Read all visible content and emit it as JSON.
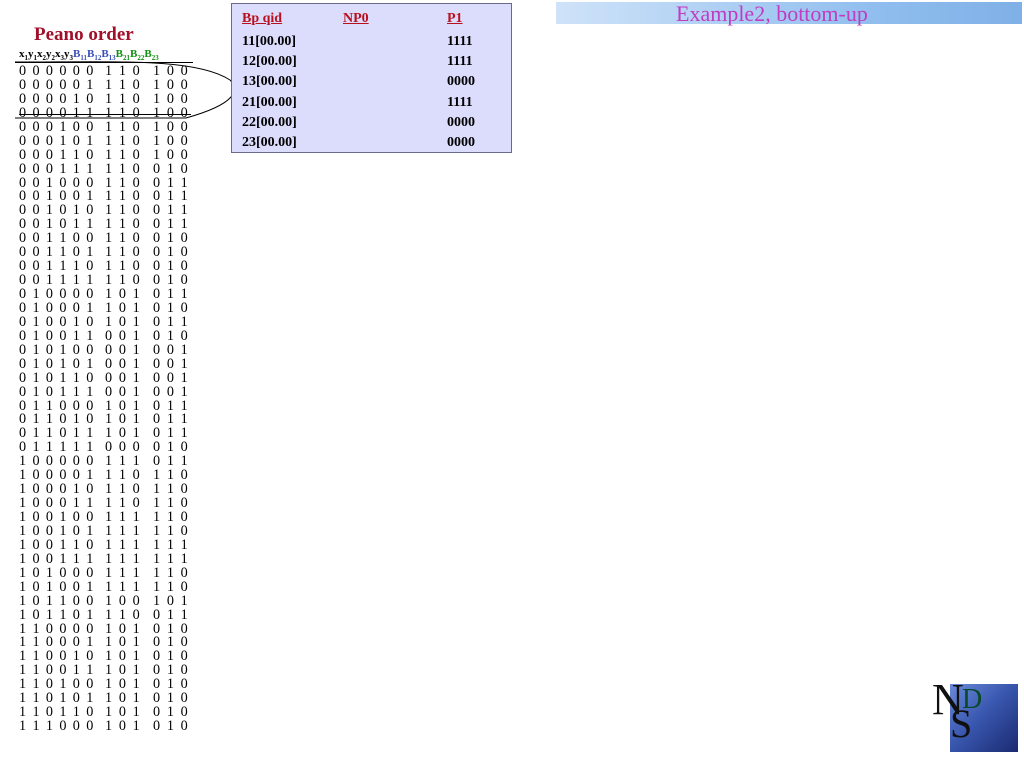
{
  "slide_title": "Example2, bottom-up",
  "peano": {
    "title": "Peano order",
    "header": {
      "x_part": [
        {
          "base": "x",
          "sub": "1"
        },
        {
          "base": "y",
          "sub": "1"
        },
        {
          "base": "x",
          "sub": "2"
        },
        {
          "base": "y",
          "sub": "2"
        },
        {
          "base": "x",
          "sub": "3"
        },
        {
          "base": "y",
          "sub": "3"
        }
      ],
      "b1_part": [
        {
          "base": "B",
          "sub": "11"
        },
        {
          "base": "B",
          "sub": "12"
        },
        {
          "base": "B",
          "sub": "13"
        }
      ],
      "b2_part": [
        {
          "base": "B",
          "sub": "21"
        },
        {
          "base": "B",
          "sub": "22"
        },
        {
          "base": "B",
          "sub": "23"
        }
      ]
    },
    "rows": [
      [
        "0 0 0 0 0 0",
        "1 1 0",
        "1 0 0"
      ],
      [
        "0 0 0 0 0 1",
        "1 1 0",
        "1 0 0"
      ],
      [
        "0 0 0 0 1 0",
        "1 1 0",
        "1 0 0"
      ],
      [
        "0 0 0 0 1 1",
        "1 1 0",
        "1 0 0"
      ],
      [
        "0 0 0 1 0 0",
        "1 1 0",
        "1 0 0"
      ],
      [
        "0 0 0 1 0 1",
        "1 1 0",
        "1 0 0"
      ],
      [
        "0 0 0 1 1 0",
        "1 1 0",
        "1 0 0"
      ],
      [
        "0 0 0 1 1 1",
        "1 1 0",
        "0 1 0"
      ],
      [
        "0 0 1 0 0 0",
        "1 1 0",
        "0 1 1"
      ],
      [
        "0 0 1 0 0 1",
        "1 1 0",
        "0 1 1"
      ],
      [
        "0 0 1 0 1 0",
        "1 1 0",
        "0 1 1"
      ],
      [
        "0 0 1 0 1 1",
        "1 1 0",
        "0 1 1"
      ],
      [
        "0 0 1 1 0 0",
        "1 1 0",
        "0 1 0"
      ],
      [
        "0 0 1 1 0 1",
        "1 1 0",
        "0 1 0"
      ],
      [
        "0 0 1 1 1 0",
        "1 1 0",
        "0 1 0"
      ],
      [
        "0 0 1 1 1 1",
        "1 1 0",
        "0 1 0"
      ],
      [
        "0 1 0 0 0 0",
        "1 0 1",
        "0 1 1"
      ],
      [
        "0 1 0 0 0 1",
        "1 0 1",
        "0 1 0"
      ],
      [
        "0 1 0 0 1 0",
        "1 0 1",
        "0 1 1"
      ],
      [
        "0 1 0 0 1 1",
        "0 0 1",
        "0 1 0"
      ],
      [
        "0 1 0 1 0 0",
        "0 0 1",
        "0 0 1"
      ],
      [
        "0 1 0 1 0 1",
        "0 0 1",
        "0 0 1"
      ],
      [
        "0 1 0 1 1 0",
        "0 0 1",
        "0 0 1"
      ],
      [
        "0 1 0 1 1 1",
        "0 0 1",
        "0 0 1"
      ],
      [
        "0 1 1 0 0 0",
        "1 0 1",
        "0 1 1"
      ],
      [
        "0 1 1 0 1 0",
        "1 0 1",
        "0 1 1"
      ],
      [
        "0 1 1 0 1 1",
        "1 0 1",
        "0 1 1"
      ],
      [
        "0 1 1 1 1 1",
        "0 0 0",
        "0 1 0"
      ],
      [
        "1 0 0 0 0 0",
        "1 1 1",
        "0 1 1"
      ],
      [
        "1 0 0 0 0 1",
        "1 1 0",
        "1 1 0"
      ],
      [
        "1 0 0 0 1 0",
        "1 1 0",
        "1 1 0"
      ],
      [
        "1 0 0 0 1 1",
        "1 1 0",
        "1 1 0"
      ],
      [
        "1 0 0 1 0 0",
        "1 1 1",
        "1 1 0"
      ],
      [
        "1 0 0 1 0 1",
        "1 1 1",
        "1 1 0"
      ],
      [
        "1 0 0 1 1 0",
        "1 1 1",
        "1 1 1"
      ],
      [
        "1 0 0 1 1 1",
        "1 1 1",
        "1 1 1"
      ],
      [
        "1 0 1 0 0 0",
        "1 1 1",
        "1 1 0"
      ],
      [
        "1 0 1 0 0 1",
        "1 1 1",
        "1 1 0"
      ],
      [
        "1 0 1 1 0 0",
        "1 0 0",
        "1 0 1"
      ],
      [
        "1 0 1 1 0 1",
        "1 1 0",
        "0 1 1"
      ],
      [
        "1 1 0 0 0 0",
        "1 0 1",
        "0 1 0"
      ],
      [
        "1 1 0 0 0 1",
        "1 0 1",
        "0 1 0"
      ],
      [
        "1 1 0 0 1 0",
        "1 0 1",
        "0 1 0"
      ],
      [
        "1 1 0 0 1 1",
        "1 0 1",
        "0 1 0"
      ],
      [
        "1 1 0 1 0 0",
        "1 0 1",
        "0 1 0"
      ],
      [
        "1 1 0 1 0 1",
        "1 0 1",
        "0 1 0"
      ],
      [
        "1 1 0 1 1 0",
        "1 0 1",
        "0 1 0"
      ],
      [
        "1 1 1 0 0 0",
        "1 0 1",
        "0 1 0"
      ]
    ]
  },
  "query_table": {
    "headers": [
      "Bp qid",
      "NP0",
      "P1"
    ],
    "rows": [
      [
        "11[00.00]",
        "",
        "1111"
      ],
      [
        "12[00.00]",
        "",
        "1111"
      ],
      [
        "13[00.00]",
        "",
        "0000"
      ],
      [
        "21[00.00]",
        "",
        "1111"
      ],
      [
        "22[00.00]",
        "",
        "0000"
      ],
      [
        "23[00.00]",
        "",
        "0000"
      ]
    ]
  },
  "logo": {
    "letters": [
      "N",
      "D",
      "S"
    ]
  },
  "colors": {
    "title": "#c03cc0",
    "peano_title": "#a0102a",
    "b1_header": "#3a50b8",
    "b2_header": "#109010",
    "table_bg": "#dcdcfc",
    "table_header": "#b8101e"
  }
}
